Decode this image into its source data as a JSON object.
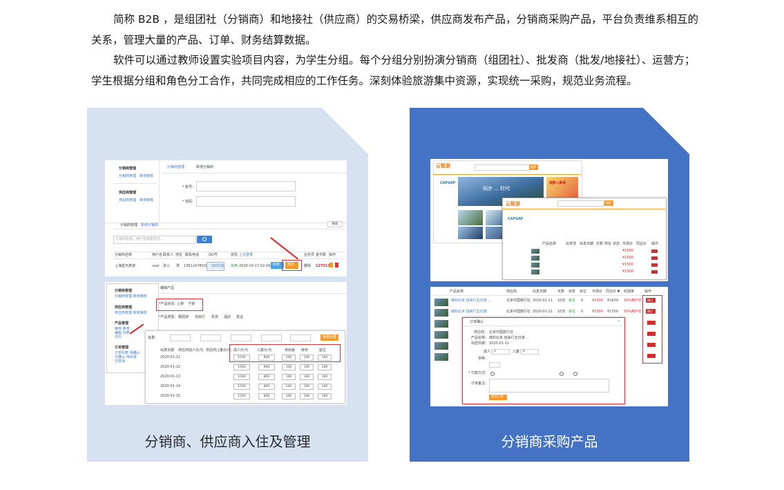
{
  "intro": {
    "p1": "简称 B2B ，是组团社（分销商）和地接社（供应商）的交易桥梁，供应商发布产品，分销商采购产品，平台负责维系相互的关系，管理大量的产品、订单、财务结算数据。",
    "p2": "软件可以通过教师设置实验项目内容，为学生分组。每个分组分别扮演分销商（组团社）、批发商（批发/地接社）、运营方；学生根据分组和角色分工合作，共同完成相应的工作任务。深刻体验旅游集中资源，实现统一采购，规范业务流程。"
  },
  "panels": {
    "left": {
      "caption": "分销商、供应商入住及管理"
    },
    "right": {
      "caption": "分销商采购产品"
    }
  },
  "shot1": {
    "sidebar_heading1": "分销商管理",
    "sidebar_link1a": "分销商管理",
    "sidebar_link1b": "新增审核",
    "sidebar_heading2": "供应商管理",
    "sidebar_link2a": "供应商管理",
    "sidebar_link2b": "新增审核",
    "tab1": "分销商管理",
    "tab2": "新增分销商",
    "label_account": "* 账号：",
    "label_password": "* 密码：",
    "subtab1": "分销商管理",
    "subtab2": "新增分销商",
    "refresh": "刷新",
    "search_placeholder": "分销商名称、用户名或者姓名...",
    "headers": [
      "分销商名称",
      "用户名",
      "联系人",
      "地址",
      "联系电话",
      "QQ号",
      "状态",
      "上次登录",
      "业务员",
      "金币数",
      "操作"
    ],
    "row": [
      "上海蓝天旅游",
      "user",
      "张三",
      "男",
      "13612478018",
      "QQ交谈",
      "启用",
      "2016-10-17 02:04:03",
      "",
      "127313",
      ""
    ],
    "btn_a": "启用",
    "btn_b": "修改",
    "btn_c": "删除"
  },
  "shot2": {
    "side_h1": "分销商管理",
    "side_h2": "供应商管理",
    "side_h3": "产品管理",
    "side_h4": "订单管理",
    "tab": "编辑产品",
    "status_label": "*产品状态：",
    "status_on": "上架",
    "status_off": "下架",
    "type_label": "*产品类型：",
    "types": [
      "跟团游",
      "自由行",
      "机票",
      "酒店",
      "签证"
    ],
    "batch_label": "批量：",
    "batch_adult": "成人价",
    "batch_child": "儿童价",
    "batch_single": "单房差",
    "batch_stock": "库存",
    "batch_seat": "座位",
    "batch_button": "批量设置",
    "table_headers": [
      "出发日期",
      "供应商成人价/元",
      "供应商儿童价/元",
      "成人价/元",
      "儿童价/元",
      "单房差",
      "库存",
      "座位"
    ],
    "dates": [
      "2020-01-11",
      "2020-01-12",
      "2020-01-13",
      "2020-01-14",
      "2020-01-15"
    ],
    "adult": "1500",
    "child": "800",
    "single": "100",
    "stock": "100",
    "seat": "100"
  },
  "shot3": {
    "logo": "云智游",
    "search_btn": "搜索",
    "banner_text": "同步 ... 时代",
    "promo_title": "观影+美食",
    "side_title": "CAPSAP",
    "list_headers": [
      "产品名称",
      "出发地",
      "出发日期",
      "天数",
      "供应",
      "状态",
      "市场价",
      "同业价",
      "操作"
    ],
    "list_price": "¥1500",
    "list_btn": "预订"
  },
  "shot4": {
    "headers": [
      "产品名称",
      "供应商",
      "出发日期",
      "天数",
      "状态",
      "余位",
      "市场价",
      "同业价 ▼",
      "利润率",
      "操作"
    ],
    "rows": [
      {
        "name": "缤纷北京 自由行五日游 ...",
        "supplier": "北京中国旅行社",
        "date": "2020-01-11",
        "days": "10天",
        "status": "余位",
        "seat": "0",
        "market": "¥1500",
        "price": "¥1639",
        "rate": "10%用户价",
        "op": "预订"
      },
      {
        "name": "缤纷北京 自由行五日游",
        "supplier": "北京中国旅行社",
        "date": "2020-01-11",
        "days": "10天",
        "status": "余位",
        "seat": "0",
        "market": "¥1500",
        "price": "¥1700",
        "rate": "10%用户价",
        "op": "预订"
      }
    ],
    "dialog": {
      "title": "订单确认",
      "supplier_label": "供应商：",
      "supplier": "北京中国旅行社",
      "product_label": "产品名称：",
      "product": "缤纷北京 自由行五日游 ...",
      "date_label": "出团日期：",
      "date": "2020-01-11",
      "type_label": "票种：",
      "adult_label": "成人：",
      "adult": "1",
      "child_label": "儿童：",
      "child": "0",
      "pay_label": "* 付款方式：",
      "remark_label": "订单备注：",
      "submit": "提交订单"
    }
  },
  "colors": {
    "panel_left": "#d6e1f2",
    "panel_right": "#4472c4",
    "accent_red": "#d9343a",
    "link_blue": "#3b78c9"
  }
}
